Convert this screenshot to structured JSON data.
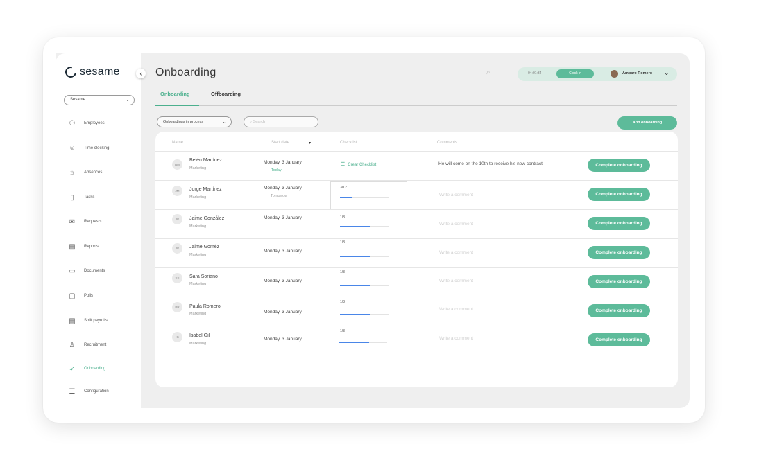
{
  "app": {
    "logo_text": "sesame"
  },
  "sidebar": {
    "company": "Sesame",
    "items": [
      {
        "label": "Employees",
        "icon": "people-icon"
      },
      {
        "label": "Time clocking",
        "icon": "location-pin-icon"
      },
      {
        "label": "Absences",
        "icon": "sun-icon"
      },
      {
        "label": "Tasks",
        "icon": "task-document-icon"
      },
      {
        "label": "Requests",
        "icon": "envelope-icon"
      },
      {
        "label": "Reports",
        "icon": "report-icon"
      },
      {
        "label": "Documents",
        "icon": "folder-icon"
      },
      {
        "label": "Polls",
        "icon": "clipboard-icon"
      },
      {
        "label": "Split payrolls",
        "icon": "payroll-icon"
      },
      {
        "label": "Recruitment",
        "icon": "recruitment-icon"
      },
      {
        "label": "Onboarding",
        "icon": "rocket-icon",
        "active": true
      },
      {
        "label": "Configuration",
        "icon": "sliders-icon"
      }
    ]
  },
  "header": {
    "title": "Onboarding",
    "clock_time": "04:01:34",
    "clock_button": "Clock in",
    "user_name": "Amparo Romero"
  },
  "tabs": [
    {
      "label": "Onboarding",
      "active": true
    },
    {
      "label": "Offboarding",
      "active": false
    }
  ],
  "toolbar": {
    "filter_value": "Onboardings in process",
    "search_placeholder": "Search",
    "add_button": "Add onboarding"
  },
  "table": {
    "columns": [
      "Name",
      "Start date",
      "Checklist",
      "Comments"
    ],
    "create_checklist_label": "Crear Checklist",
    "complete_label": "Complete onboarding",
    "comment_placeholder": "Write a comment",
    "rows": [
      {
        "initials": "BM",
        "name": "Belén Martínez",
        "dept": "Marketing",
        "date": "Monday, 3 January",
        "note": "Today",
        "checklist": null,
        "comment": "He will come on the 10th to receive his new contract"
      },
      {
        "initials": "JM",
        "name": "Jorge Martínez",
        "dept": "Marketing",
        "date": "Monday, 3 January",
        "note": "Tomorrow",
        "checklist": "3/12",
        "progress": 0.25,
        "comment": ""
      },
      {
        "initials": "JG",
        "name": "Jaime González",
        "dept": "Marketing",
        "date": "Monday, 3 January",
        "note": "",
        "checklist": "1/3",
        "progress": 0.63,
        "comment": ""
      },
      {
        "initials": "JG",
        "name": "Jaime Goméz",
        "dept": "Marketing",
        "date": "Monday, 3 January",
        "note": "",
        "checklist": "1/3",
        "progress": 0.63,
        "comment": ""
      },
      {
        "initials": "SS",
        "name": "Sara Soriano",
        "dept": "Marketing",
        "date": "Monday, 3 January",
        "note": "",
        "checklist": "1/3",
        "progress": 0.63,
        "comment": ""
      },
      {
        "initials": "PR",
        "name": "Paula Romero",
        "dept": "Marketing",
        "date": "Monday, 3 January",
        "note": "",
        "checklist": "1/3",
        "progress": 0.63,
        "comment": ""
      },
      {
        "initials": "IG",
        "name": "Isabel Gil",
        "dept": "Marketing",
        "date": "Monday, 3 January",
        "note": "",
        "checklist": "1/3",
        "progress": 0.63,
        "comment": ""
      }
    ]
  },
  "colors": {
    "accent": "#5dbb9a",
    "progress": "#4a86e8",
    "text": "#333333"
  }
}
